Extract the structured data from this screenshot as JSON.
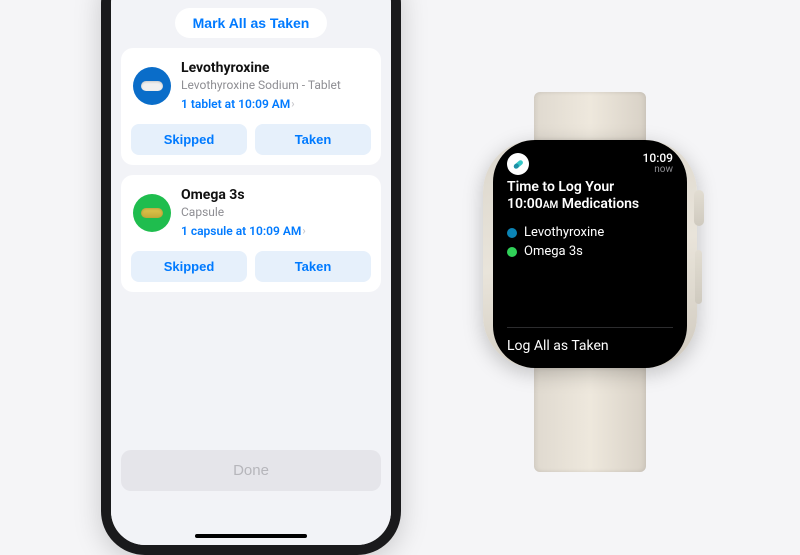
{
  "phone": {
    "mark_all_label": "Mark All as Taken",
    "done_label": "Done",
    "skipped_label": "Skipped",
    "taken_label": "Taken",
    "meds": [
      {
        "name": "Levothyroxine",
        "subtitle": "Levothyroxine Sodium - Tablet",
        "schedule": "1 tablet at 10:09 AM",
        "color": "blue",
        "pill": "white"
      },
      {
        "name": "Omega 3s",
        "subtitle": "Capsule",
        "schedule": "1 capsule at 10:09 AM",
        "color": "green",
        "pill": "yellow"
      }
    ]
  },
  "watch": {
    "time": "10:09",
    "now_label": "now",
    "title_line1": "Time to Log Your",
    "title_timestr": "10:00",
    "title_ampm": "AM",
    "title_after": " Medications",
    "items": [
      {
        "label": "Levothyroxine",
        "dot": "dblue"
      },
      {
        "label": "Omega 3s",
        "dot": "dgreen"
      }
    ],
    "action_label": "Log All as Taken"
  },
  "colors": {
    "accent": "#007aff",
    "icon_blue": "#0a6dc9",
    "icon_green": "#1fbd4e",
    "watch_dot_blue": "#0b84b5",
    "watch_dot_green": "#30d158"
  }
}
